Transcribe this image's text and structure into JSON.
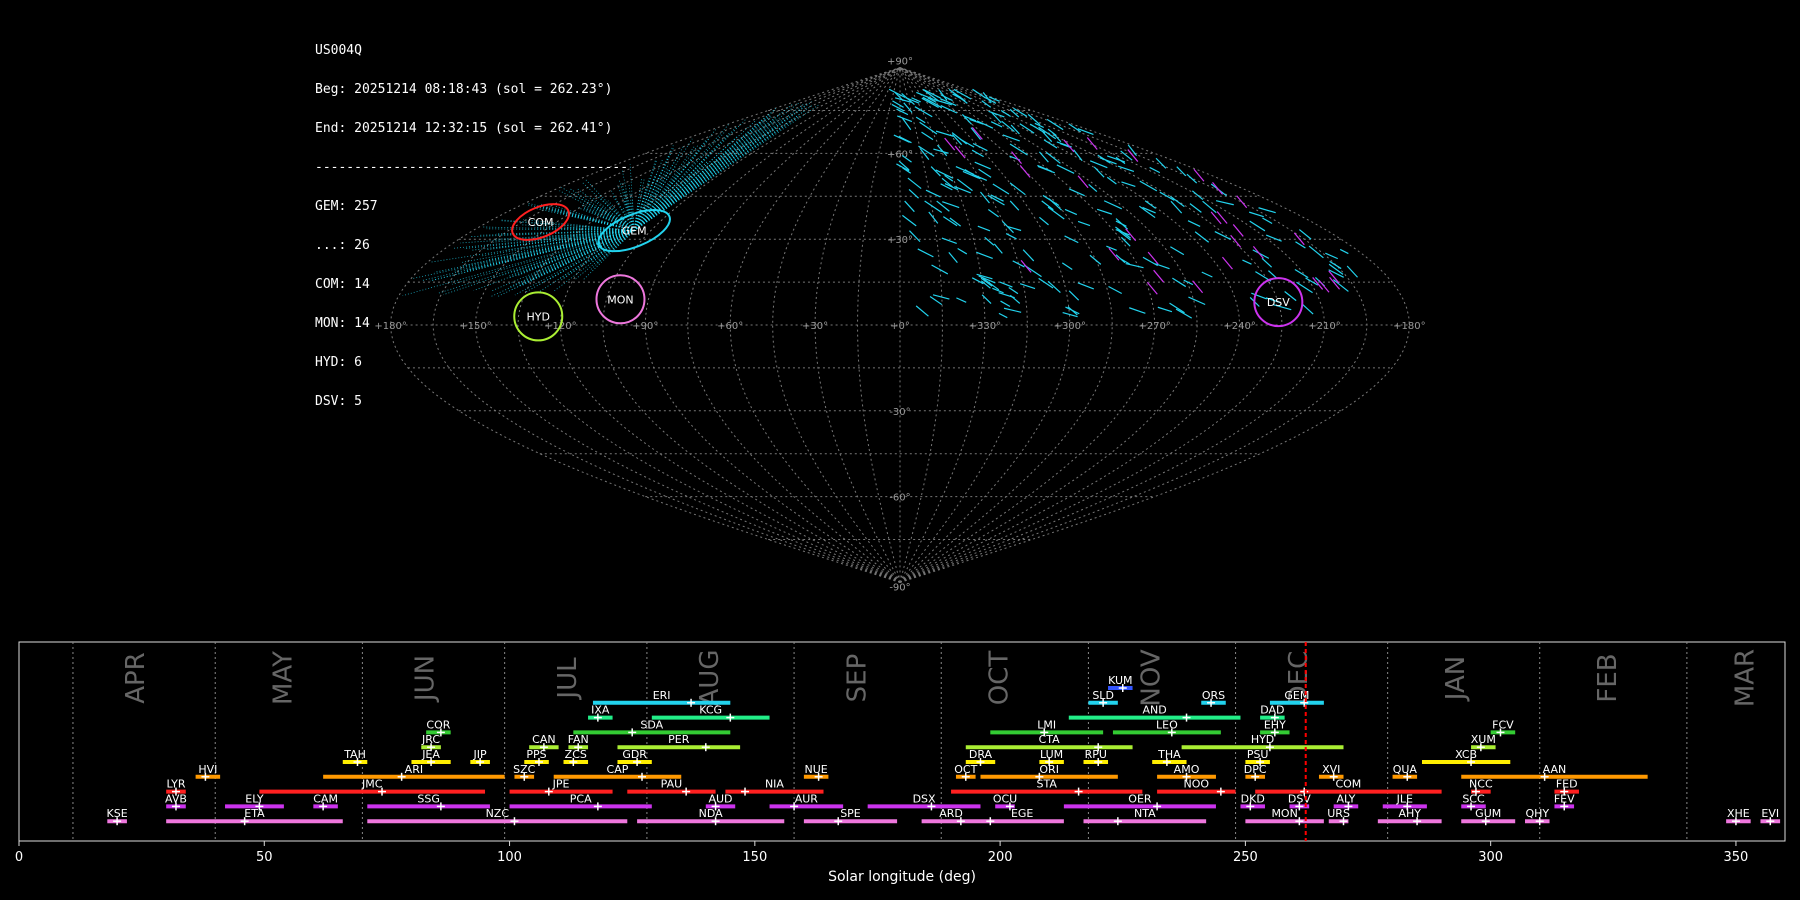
{
  "info": {
    "station": "US004Q",
    "begin": "Beg: 20251214 08:18:43 (sol = 262.23°)",
    "end": "End: 20251214 12:32:15 (sol = 262.41°)",
    "separator": "----------------------------------------",
    "counts": [
      "GEM: 257",
      "...: 26",
      "COM: 14",
      "MON: 14",
      "HYD: 6",
      "DSV: 5"
    ]
  },
  "colors": {
    "background": "#000000",
    "grid": "#777777",
    "cyan": "#22d3ee",
    "red": "#ff2020",
    "orange": "#ff9900",
    "yellow": "#ffee00",
    "lime": "#aaee33",
    "green": "#33cc33",
    "teal": "#22ee88",
    "magenta": "#cc33ee",
    "pink": "#ee77dd",
    "blue": "#3355ff",
    "current_sol": "#ff0000"
  },
  "chart_data": [
    {
      "type": "scatter",
      "projection": "sinusoidal",
      "lon_ticks": [
        "+180°",
        "+150°",
        "+120°",
        "+90°",
        "+60°",
        "+30°",
        "+0°",
        "+330°",
        "+300°",
        "+270°",
        "+240°",
        "+210°",
        "+180°"
      ],
      "lat_ticks": [
        "+90°",
        "+60°",
        "+30°",
        "-30°",
        "-60°",
        "-90°"
      ],
      "radiants": [
        {
          "name": "COM",
          "lon": 157,
          "lat": 36,
          "color": "red"
        },
        {
          "name": "GEM",
          "lon": 112,
          "lat": 33,
          "color": "cyan"
        },
        {
          "name": "MON",
          "lon": 100,
          "lat": 9,
          "color": "pink"
        },
        {
          "name": "HYD",
          "lon": 128,
          "lat": 3,
          "color": "lime"
        },
        {
          "name": "DSV",
          "lon": 225,
          "lat": 8,
          "color": "magenta"
        }
      ]
    },
    {
      "type": "timeline",
      "xlabel": "Solar longitude (deg)",
      "xlim": [
        0,
        360
      ],
      "xticks": [
        0,
        50,
        100,
        150,
        200,
        250,
        300,
        350
      ],
      "current_sol": 262.3,
      "months": [
        {
          "name": "APR",
          "at": 24
        },
        {
          "name": "MAY",
          "at": 54
        },
        {
          "name": "JUN",
          "at": 83
        },
        {
          "name": "JUL",
          "at": 112
        },
        {
          "name": "AUG",
          "at": 141
        },
        {
          "name": "SEP",
          "at": 171
        },
        {
          "name": "OCT",
          "at": 200
        },
        {
          "name": "NOV",
          "at": 231
        },
        {
          "name": "DEC",
          "at": 261
        },
        {
          "name": "JAN",
          "at": 293
        },
        {
          "name": "FEB",
          "at": 324
        },
        {
          "name": "MAR",
          "at": 352
        }
      ],
      "month_dividers": [
        11,
        40,
        70,
        99,
        128,
        158,
        188,
        218,
        248,
        279,
        310,
        340
      ],
      "showers": [
        {
          "name": "KUM",
          "start": 222,
          "end": 227,
          "peak": 225,
          "row": 11,
          "color": "blue"
        },
        {
          "name": "ERI",
          "start": 117,
          "end": 145,
          "peak": 137,
          "row": 10,
          "color": "cyan"
        },
        {
          "name": "SLD",
          "start": 218,
          "end": 224,
          "peak": 221,
          "row": 10,
          "color": "cyan"
        },
        {
          "name": "ORS",
          "start": 241,
          "end": 246,
          "peak": 243,
          "row": 10,
          "color": "cyan"
        },
        {
          "name": "GEM",
          "start": 255,
          "end": 266,
          "peak": 262,
          "row": 10,
          "color": "cyan"
        },
        {
          "name": "IXA",
          "start": 116,
          "end": 121,
          "peak": 118,
          "row": 9,
          "color": "teal"
        },
        {
          "name": "KCG",
          "start": 129,
          "end": 153,
          "peak": 145,
          "row": 9,
          "color": "teal"
        },
        {
          "name": "AND",
          "start": 214,
          "end": 249,
          "peak": 238,
          "row": 9,
          "color": "teal"
        },
        {
          "name": "DAD",
          "start": 253,
          "end": 258,
          "peak": 256,
          "row": 9,
          "color": "teal"
        },
        {
          "name": "COR",
          "start": 83,
          "end": 88,
          "peak": 86,
          "row": 8,
          "color": "green"
        },
        {
          "name": "SDA",
          "start": 113,
          "end": 145,
          "peak": 125,
          "row": 8,
          "color": "green"
        },
        {
          "name": "LMI",
          "start": 198,
          "end": 221,
          "peak": 209,
          "row": 8,
          "color": "green"
        },
        {
          "name": "LEO",
          "start": 223,
          "end": 245,
          "peak": 235,
          "row": 8,
          "color": "green"
        },
        {
          "name": "EHY",
          "start": 253,
          "end": 259,
          "peak": 256,
          "row": 8,
          "color": "green"
        },
        {
          "name": "FCV",
          "start": 300,
          "end": 305,
          "peak": 302,
          "row": 8,
          "color": "green"
        },
        {
          "name": "JRC",
          "start": 82,
          "end": 86,
          "peak": 84,
          "row": 7,
          "color": "lime"
        },
        {
          "name": "CAN",
          "start": 104,
          "end": 110,
          "peak": 107,
          "row": 7,
          "color": "lime"
        },
        {
          "name": "FAN",
          "start": 112,
          "end": 116,
          "peak": 114,
          "row": 7,
          "color": "lime"
        },
        {
          "name": "PER",
          "start": 122,
          "end": 147,
          "peak": 140,
          "row": 7,
          "color": "lime"
        },
        {
          "name": "CTA",
          "start": 193,
          "end": 227,
          "peak": 220,
          "row": 7,
          "color": "lime"
        },
        {
          "name": "HYD",
          "start": 237,
          "end": 270,
          "peak": 255,
          "row": 7,
          "color": "lime"
        },
        {
          "name": "XUM",
          "start": 296,
          "end": 301,
          "peak": 298,
          "row": 7,
          "color": "lime"
        },
        {
          "name": "TAH",
          "start": 66,
          "end": 71,
          "peak": 69,
          "row": 6,
          "color": "yellow"
        },
        {
          "name": "JEA",
          "start": 80,
          "end": 88,
          "peak": 84,
          "row": 6,
          "color": "yellow"
        },
        {
          "name": "JIP",
          "start": 92,
          "end": 96,
          "peak": 94,
          "row": 6,
          "color": "yellow"
        },
        {
          "name": "PPS",
          "start": 103,
          "end": 108,
          "peak": 106,
          "row": 6,
          "color": "yellow"
        },
        {
          "name": "ZCS",
          "start": 111,
          "end": 116,
          "peak": 113,
          "row": 6,
          "color": "yellow"
        },
        {
          "name": "GDR",
          "start": 122,
          "end": 129,
          "peak": 126,
          "row": 6,
          "color": "yellow"
        },
        {
          "name": "DRA",
          "start": 193,
          "end": 199,
          "peak": 196,
          "row": 6,
          "color": "yellow"
        },
        {
          "name": "LUM",
          "start": 208,
          "end": 213,
          "peak": 210,
          "row": 6,
          "color": "yellow"
        },
        {
          "name": "RPU",
          "start": 217,
          "end": 222,
          "peak": 220,
          "row": 6,
          "color": "yellow"
        },
        {
          "name": "THA",
          "start": 231,
          "end": 238,
          "peak": 234,
          "row": 6,
          "color": "yellow"
        },
        {
          "name": "PSU",
          "start": 250,
          "end": 255,
          "peak": 253,
          "row": 6,
          "color": "yellow"
        },
        {
          "name": "XCB",
          "start": 286,
          "end": 304,
          "peak": 296,
          "row": 6,
          "color": "yellow"
        },
        {
          "name": "HVI",
          "start": 36,
          "end": 41,
          "peak": 38,
          "row": 5,
          "color": "orange"
        },
        {
          "name": "ARI",
          "start": 62,
          "end": 99,
          "peak": 78,
          "row": 5,
          "color": "orange"
        },
        {
          "name": "SZC",
          "start": 101,
          "end": 105,
          "peak": 103,
          "row": 5,
          "color": "orange"
        },
        {
          "name": "CAP",
          "start": 109,
          "end": 135,
          "peak": 127,
          "row": 5,
          "color": "orange"
        },
        {
          "name": "NUE",
          "start": 160,
          "end": 165,
          "peak": 163,
          "row": 5,
          "color": "orange"
        },
        {
          "name": "OCT",
          "start": 191,
          "end": 195,
          "peak": 193,
          "row": 5,
          "color": "orange"
        },
        {
          "name": "ORI",
          "start": 196,
          "end": 224,
          "peak": 208,
          "row": 5,
          "color": "orange"
        },
        {
          "name": "AMO",
          "start": 232,
          "end": 244,
          "peak": 238,
          "row": 5,
          "color": "orange"
        },
        {
          "name": "DPC",
          "start": 250,
          "end": 254,
          "peak": 252,
          "row": 5,
          "color": "orange"
        },
        {
          "name": "XVI",
          "start": 265,
          "end": 270,
          "peak": 268,
          "row": 5,
          "color": "orange"
        },
        {
          "name": "QUA",
          "start": 280,
          "end": 285,
          "peak": 283,
          "row": 5,
          "color": "orange"
        },
        {
          "name": "AAN",
          "start": 294,
          "end": 332,
          "peak": 311,
          "row": 5,
          "color": "orange"
        },
        {
          "name": "LYR",
          "start": 30,
          "end": 34,
          "peak": 32,
          "row": 4,
          "color": "red"
        },
        {
          "name": "JMC",
          "start": 49,
          "end": 95,
          "peak": 74,
          "row": 4,
          "color": "red"
        },
        {
          "name": "JPE",
          "start": 100,
          "end": 121,
          "peak": 108,
          "row": 4,
          "color": "red"
        },
        {
          "name": "PAU",
          "start": 124,
          "end": 142,
          "peak": 136,
          "row": 4,
          "color": "red"
        },
        {
          "name": "NIA",
          "start": 144,
          "end": 164,
          "peak": 148,
          "row": 4,
          "color": "red"
        },
        {
          "name": "STA",
          "start": 190,
          "end": 229,
          "peak": 216,
          "row": 4,
          "color": "red"
        },
        {
          "name": "NOO",
          "start": 232,
          "end": 248,
          "peak": 245,
          "row": 4,
          "color": "red"
        },
        {
          "name": "COM",
          "start": 252,
          "end": 290,
          "peak": 262,
          "row": 4,
          "color": "red"
        },
        {
          "name": "NCC",
          "start": 296,
          "end": 300,
          "peak": 297,
          "row": 4,
          "color": "red"
        },
        {
          "name": "FED",
          "start": 313,
          "end": 318,
          "peak": 315,
          "row": 4,
          "color": "red"
        },
        {
          "name": "AVB",
          "start": 30,
          "end": 34,
          "peak": 32,
          "row": 3,
          "color": "magenta"
        },
        {
          "name": "ELY",
          "start": 42,
          "end": 54,
          "peak": 49,
          "row": 3,
          "color": "magenta"
        },
        {
          "name": "CAM",
          "start": 60,
          "end": 65,
          "peak": 62,
          "row": 3,
          "color": "magenta"
        },
        {
          "name": "SSG",
          "start": 71,
          "end": 96,
          "peak": 86,
          "row": 3,
          "color": "magenta"
        },
        {
          "name": "PCA",
          "start": 100,
          "end": 129,
          "peak": 118,
          "row": 3,
          "color": "magenta"
        },
        {
          "name": "AUD",
          "start": 140,
          "end": 146,
          "peak": 142,
          "row": 3,
          "color": "magenta"
        },
        {
          "name": "AUR",
          "start": 153,
          "end": 168,
          "peak": 158,
          "row": 3,
          "color": "magenta"
        },
        {
          "name": "DSX",
          "start": 173,
          "end": 196,
          "peak": 186,
          "row": 3,
          "color": "magenta"
        },
        {
          "name": "OCU",
          "start": 199,
          "end": 203,
          "peak": 202,
          "row": 3,
          "color": "magenta"
        },
        {
          "name": "OER",
          "start": 213,
          "end": 244,
          "peak": 232,
          "row": 3,
          "color": "magenta"
        },
        {
          "name": "DKD",
          "start": 249,
          "end": 254,
          "peak": 251,
          "row": 3,
          "color": "magenta"
        },
        {
          "name": "DSV",
          "start": 259,
          "end": 263,
          "peak": 261,
          "row": 3,
          "color": "magenta"
        },
        {
          "name": "ALY",
          "start": 268,
          "end": 273,
          "peak": 271,
          "row": 3,
          "color": "magenta"
        },
        {
          "name": "JLE",
          "start": 278,
          "end": 287,
          "peak": 283,
          "row": 3,
          "color": "magenta"
        },
        {
          "name": "SCC",
          "start": 294,
          "end": 299,
          "peak": 296,
          "row": 3,
          "color": "magenta"
        },
        {
          "name": "FEV",
          "start": 313,
          "end": 317,
          "peak": 315,
          "row": 3,
          "color": "magenta"
        },
        {
          "name": "KSE",
          "start": 18,
          "end": 22,
          "peak": 20,
          "row": 2,
          "color": "pink"
        },
        {
          "name": "ETA",
          "start": 30,
          "end": 66,
          "peak": 46,
          "row": 2,
          "color": "pink"
        },
        {
          "name": "NZC",
          "start": 71,
          "end": 124,
          "peak": 101,
          "row": 2,
          "color": "pink"
        },
        {
          "name": "NDA",
          "start": 126,
          "end": 156,
          "peak": 142,
          "row": 2,
          "color": "pink"
        },
        {
          "name": "SPE",
          "start": 160,
          "end": 179,
          "peak": 167,
          "row": 2,
          "color": "pink"
        },
        {
          "name": "ARD",
          "start": 184,
          "end": 196,
          "peak": 192,
          "row": 2,
          "color": "pink"
        },
        {
          "name": "EGE",
          "start": 196,
          "end": 213,
          "peak": 198,
          "row": 2,
          "color": "pink"
        },
        {
          "name": "NTA",
          "start": 217,
          "end": 242,
          "peak": 224,
          "row": 2,
          "color": "pink"
        },
        {
          "name": "MON",
          "start": 250,
          "end": 266,
          "peak": 261,
          "row": 2,
          "color": "pink"
        },
        {
          "name": "URS",
          "start": 267,
          "end": 271,
          "peak": 270,
          "row": 2,
          "color": "pink"
        },
        {
          "name": "AHY",
          "start": 277,
          "end": 290,
          "peak": 285,
          "row": 2,
          "color": "pink"
        },
        {
          "name": "GUM",
          "start": 294,
          "end": 305,
          "peak": 299,
          "row": 2,
          "color": "pink"
        },
        {
          "name": "QHY",
          "start": 307,
          "end": 312,
          "peak": 310,
          "row": 2,
          "color": "pink"
        },
        {
          "name": "XHE",
          "start": 348,
          "end": 353,
          "peak": 350,
          "row": 2,
          "color": "pink"
        },
        {
          "name": "EVI",
          "start": 355,
          "end": 359,
          "peak": 357,
          "row": 2,
          "color": "pink"
        }
      ]
    }
  ]
}
